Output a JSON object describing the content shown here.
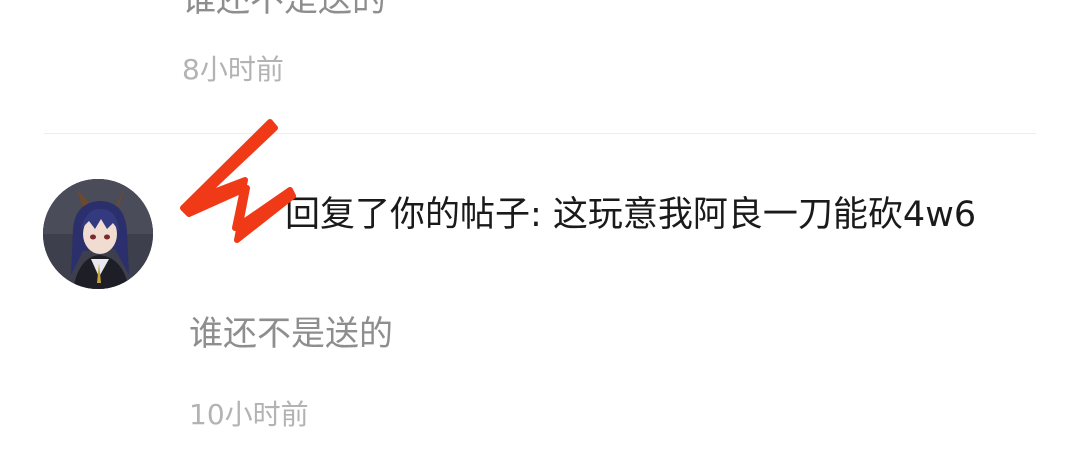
{
  "previous_notification": {
    "quote": "谁还不是送的",
    "time": "8小时前"
  },
  "notification": {
    "username": "",
    "action": "回复了你的帖子: ",
    "post_text": "这玩意我阿良一刀能砍4w6",
    "reply_text": "谁还不是送的",
    "time": "10小时前"
  },
  "colors": {
    "background": "#ffffff",
    "text_primary": "#1a1a1a",
    "text_secondary": "#8e8e8e",
    "text_time": "#b3b3b3",
    "divider": "#ededed",
    "redaction_scribble": "#f03a17"
  }
}
